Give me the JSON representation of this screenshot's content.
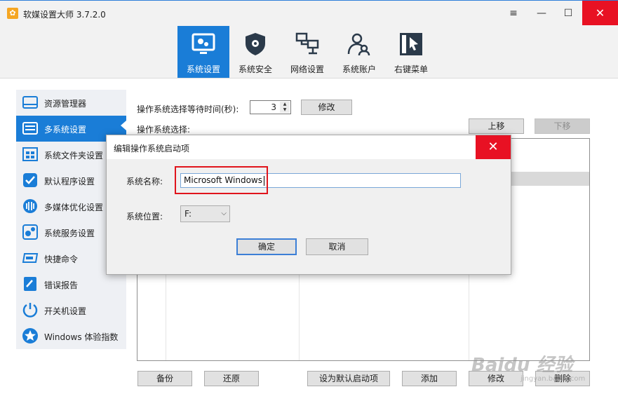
{
  "window": {
    "app_title": "软媒设置大师 3.7.2.0",
    "controls": {
      "menu": "≡",
      "minimize": "—",
      "maximize": "☐",
      "close": "✕"
    }
  },
  "toolbar": {
    "items": [
      {
        "label": "系统设置",
        "icon": "gear-screen-icon",
        "active": true
      },
      {
        "label": "系统安全",
        "icon": "shield-icon",
        "active": false
      },
      {
        "label": "网络设置",
        "icon": "network-icon",
        "active": false
      },
      {
        "label": "系统账户",
        "icon": "users-icon",
        "active": false
      },
      {
        "label": "右键菜单",
        "icon": "cursor-menu-icon",
        "active": false
      }
    ]
  },
  "sidebar": {
    "items": [
      {
        "label": "资源管理器",
        "icon": "explorer-icon"
      },
      {
        "label": "多系统设置",
        "icon": "multi-system-icon",
        "active": true
      },
      {
        "label": "系统文件夹设置",
        "icon": "windows-folder-icon"
      },
      {
        "label": "默认程序设置",
        "icon": "check-shield-icon"
      },
      {
        "label": "多媒体优化设置",
        "icon": "media-icon"
      },
      {
        "label": "系统服务设置",
        "icon": "service-gear-icon"
      },
      {
        "label": "快捷命令",
        "icon": "shortcut-icon"
      },
      {
        "label": "错误报告",
        "icon": "report-icon"
      },
      {
        "label": "开关机设置",
        "icon": "power-icon"
      },
      {
        "label": "Windows 体验指数",
        "icon": "star-icon"
      }
    ]
  },
  "main": {
    "wait_label": "操作系统选择等待时间(秒):",
    "wait_value": "3",
    "modify_button": "修改",
    "os_select_label": "操作系统选择:",
    "move_up": "上移",
    "move_down": "下移",
    "bottom_buttons": {
      "backup": "备份",
      "restore": "还原",
      "set_default": "设为默认启动项",
      "add": "添加",
      "edit": "修改",
      "delete": "删除"
    }
  },
  "dialog": {
    "title": "编辑操作系统启动项",
    "close": "✕",
    "name_label": "系统名称:",
    "name_value": "Microsoft Windows",
    "location_label": "系统位置:",
    "location_value": "F:",
    "ok": "确定",
    "cancel": "取消"
  },
  "watermark": {
    "main": "Baidu 经验",
    "sub": "jingyan.baidu.com"
  },
  "colors": {
    "accent": "#1a7dd7",
    "close": "#e81123",
    "highlight": "#e0141c"
  }
}
